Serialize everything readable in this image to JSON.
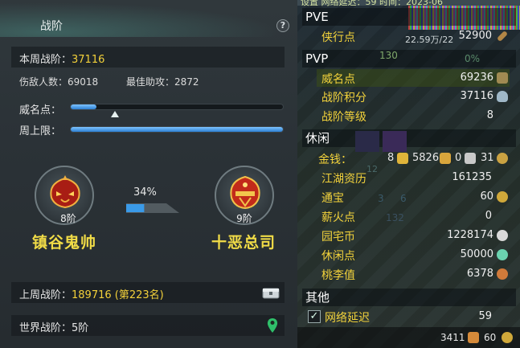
{
  "left": {
    "title": "战阶",
    "help": "?",
    "week_label": "本周战阶：",
    "week_value": "37116",
    "kills_label": "伤敌人数：69018",
    "assist_label": "最佳助攻：2872",
    "fame_label": "威名点：",
    "fame_fill": 0.12,
    "fame_marker": 0.21,
    "weekly_cap_label": "周上限：",
    "weekly_cap_fill": 1.0,
    "current_rank": {
      "level": "8阶",
      "name": "镇谷鬼帅"
    },
    "next_rank": {
      "level": "9阶",
      "name": "十恶总司"
    },
    "progress_pct_text": "34%",
    "progress": 0.34,
    "last_week_label": "上周战阶：",
    "last_week_value": "189716 (第223名)",
    "world_label": "世界战阶：5阶"
  },
  "right": {
    "top_strip_text": "设置    网络延迟：59   时间：2023-06",
    "glitch_caption": "22.59万/22",
    "pve": {
      "title": "PVE",
      "rows": [
        {
          "label": "侠行点",
          "value": "52900"
        }
      ]
    },
    "pvp": {
      "title": "PVP",
      "bg_text_1": "130",
      "bg_text_2": "0%",
      "rows": [
        {
          "label": "威名点",
          "value": "69236"
        },
        {
          "label": "战阶积分",
          "value": "37116"
        },
        {
          "label": "战阶等级",
          "value": "8"
        }
      ]
    },
    "leisure": {
      "title": "休闲",
      "gold_label": "金钱：",
      "gold_values": [
        "8",
        "5826",
        "0",
        "31"
      ],
      "bg_text_1": "12",
      "bg_text_2": "3",
      "bg_text_3": "6",
      "bg_text_4": "132",
      "rows": [
        {
          "label": "江湖资历",
          "value": "161235"
        },
        {
          "label": "通宝",
          "value": "60"
        },
        {
          "label": "薪火点",
          "value": "0"
        },
        {
          "label": "园宅币",
          "value": "1228174"
        },
        {
          "label": "休闲点",
          "value": "50000"
        },
        {
          "label": "桃李值",
          "value": "6378"
        }
      ]
    },
    "other": {
      "title": "其他",
      "latency_label": "网络延迟",
      "latency_value": "59",
      "latency_checked": "✓"
    },
    "footer": {
      "value1": "3411",
      "value2": "60"
    }
  },
  "colors": {
    "accent_gold": "#f2d23b",
    "bar_blue": "#3a8ee0"
  }
}
